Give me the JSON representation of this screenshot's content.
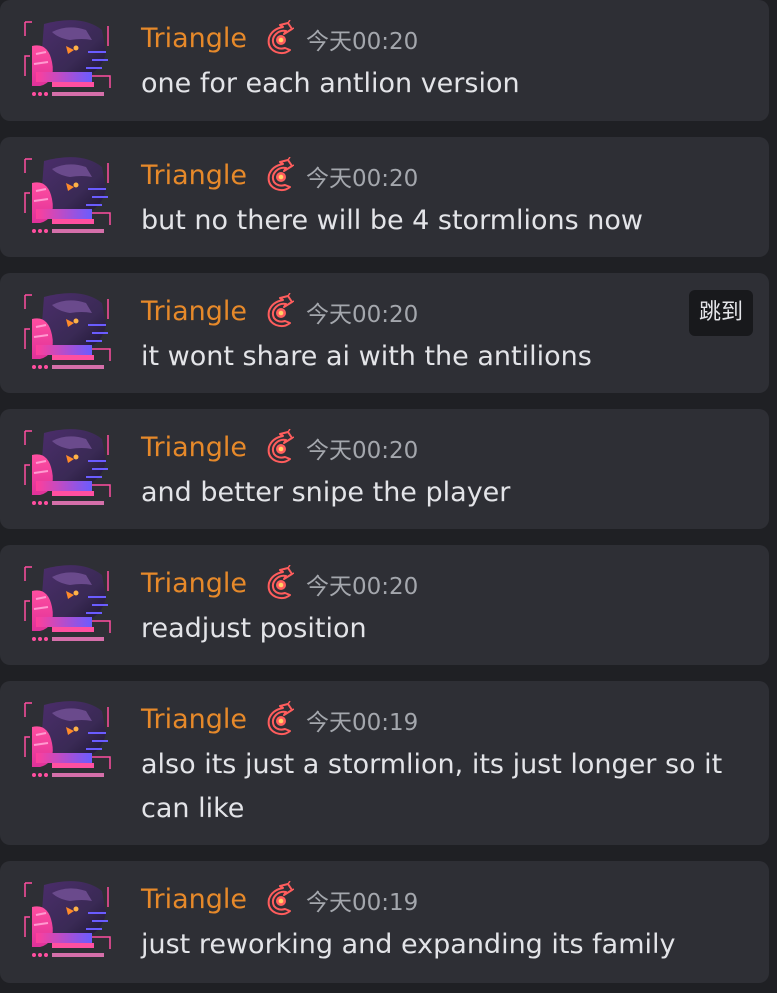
{
  "jump_label": "跳到",
  "colors": {
    "background": "#1f2024",
    "card": "#2e2f35",
    "username": "#e6892a",
    "timestamp": "#a4a7ad",
    "message": "#e3e4e8"
  },
  "messages": [
    {
      "author": "Triangle",
      "time": "今天00:20",
      "text": "one for each antlion version"
    },
    {
      "author": "Triangle",
      "time": "今天00:20",
      "text": "but no there will be 4 stormlions now"
    },
    {
      "author": "Triangle",
      "time": "今天00:20",
      "text": "it wont share ai with the antilions",
      "jump_visible": true
    },
    {
      "author": "Triangle",
      "time": "今天00:20",
      "text": "and better snipe the player"
    },
    {
      "author": "Triangle",
      "time": "今天00:20",
      "text": "readjust position"
    },
    {
      "author": "Triangle",
      "time": "今天00:19",
      "text": "also its just a stormlion, its just longer so it can like"
    },
    {
      "author": "Triangle",
      "time": "今天00:19",
      "text": "just reworking and expanding its family"
    }
  ]
}
